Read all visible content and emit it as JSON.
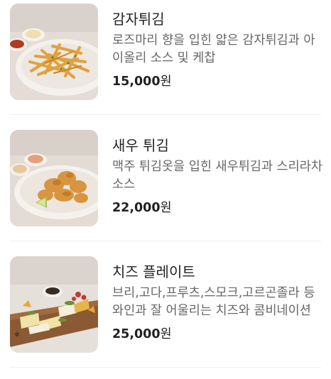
{
  "menu": {
    "items": [
      {
        "name": "감자튀김",
        "description": "로즈마리 향을 입힌 얇은 감자튀김과 아이올리 소스 및 케찹",
        "price": "15,000",
        "currency": "원",
        "image_icon": "french-fries-photo"
      },
      {
        "name": "새우 튀김",
        "description": "맥주 튀김옷을 입힌 새우튀김과 스리라차 소스",
        "price": "22,000",
        "currency": "원",
        "image_icon": "fried-shrimp-photo"
      },
      {
        "name": "치즈 플레이트",
        "description": "브리,고다,프루츠,스모크,고르곤졸라 등 와인과 잘 어울리는 치즈와 콤비네이션",
        "price": "25,000",
        "currency": "원",
        "image_icon": "cheese-plate-photo"
      }
    ]
  },
  "colors": {
    "title": "#222222",
    "description": "#666666",
    "divider": "#efefef"
  }
}
